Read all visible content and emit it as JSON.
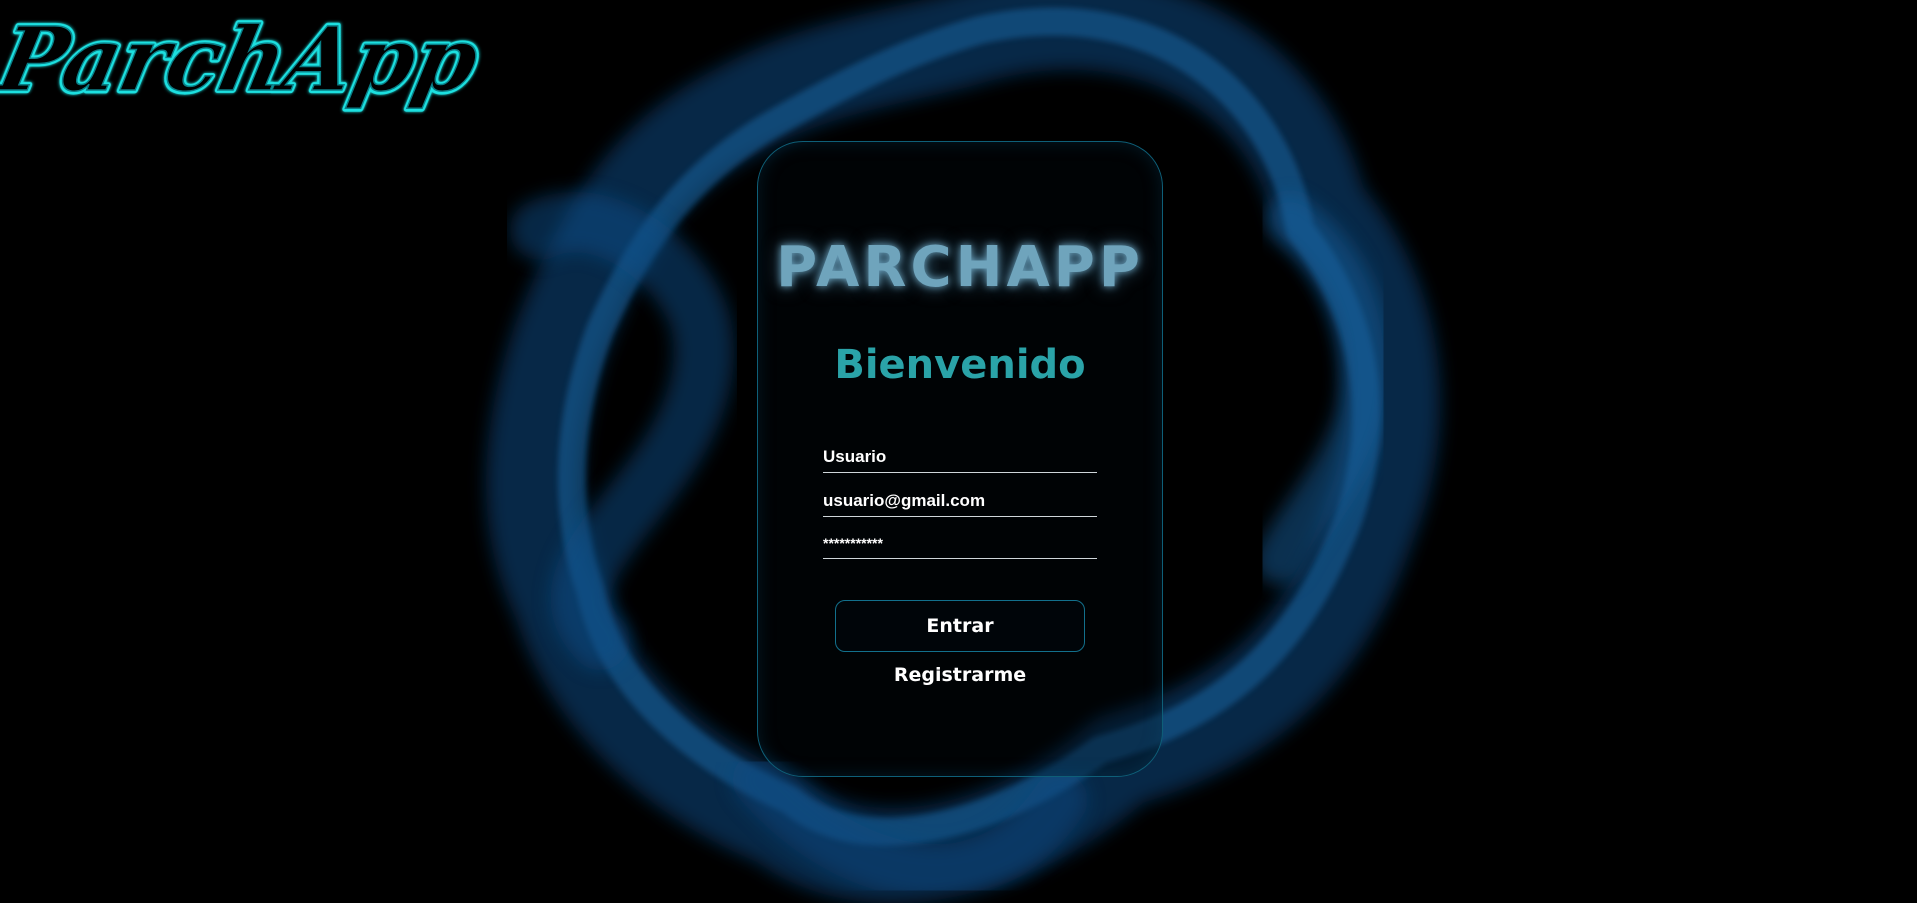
{
  "app": {
    "brand_logo_text": "ParchApp",
    "card_logo_text": "PARCHAPP",
    "accent_color": "#1ee0e0",
    "welcome_color": "#2aa3a8",
    "ring_color": "#0e4f86"
  },
  "login": {
    "title": "Bienvenido",
    "user_field": {
      "value": "Usuario"
    },
    "email_field": {
      "value": "usuario@gmail.com"
    },
    "password_field": {
      "value": "***********"
    },
    "submit_label": "Entrar",
    "register_label": "Registrarme"
  }
}
